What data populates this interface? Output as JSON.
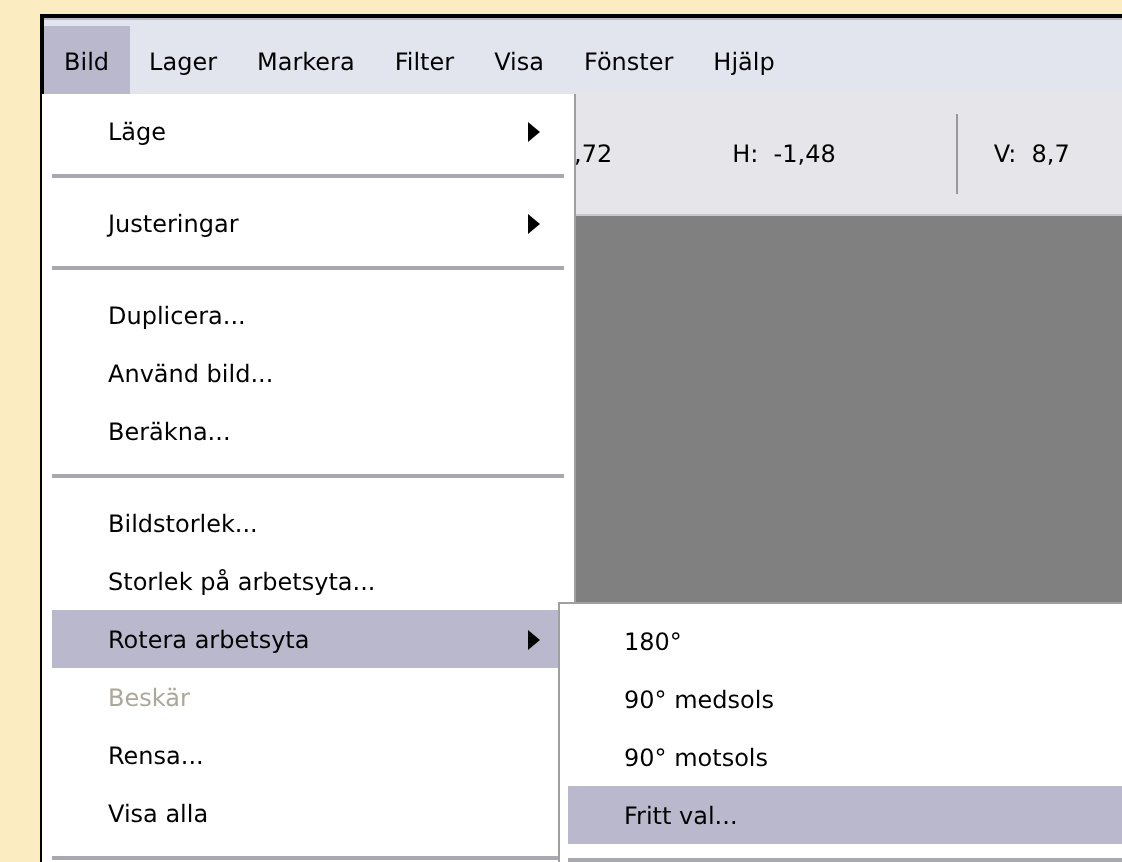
{
  "menubar": [
    {
      "label": "Bild",
      "selected": true
    },
    {
      "label": "Lager",
      "selected": false
    },
    {
      "label": "Markera",
      "selected": false
    },
    {
      "label": "Filter",
      "selected": false
    },
    {
      "label": "Visa",
      "selected": false
    },
    {
      "label": "Fönster",
      "selected": false
    },
    {
      "label": "Hjälp",
      "selected": false
    }
  ],
  "toolbar": {
    "readings": [
      ",72",
      "H:  -1,48",
      "V:  8,7"
    ]
  },
  "menu": {
    "items": [
      {
        "kind": "item",
        "label": "Läge",
        "submenu": true,
        "disabled": false,
        "selected": false
      },
      {
        "kind": "separator"
      },
      {
        "kind": "item",
        "label": "Justeringar",
        "submenu": true,
        "disabled": false,
        "selected": false
      },
      {
        "kind": "separator"
      },
      {
        "kind": "item",
        "label": "Duplicera...",
        "submenu": false,
        "disabled": false,
        "selected": false
      },
      {
        "kind": "item",
        "label": "Använd bild...",
        "submenu": false,
        "disabled": false,
        "selected": false
      },
      {
        "kind": "item",
        "label": "Beräkna...",
        "submenu": false,
        "disabled": false,
        "selected": false
      },
      {
        "kind": "separator"
      },
      {
        "kind": "item",
        "label": "Bildstorlek...",
        "submenu": false,
        "disabled": false,
        "selected": false
      },
      {
        "kind": "item",
        "label": "Storlek på arbetsyta...",
        "submenu": false,
        "disabled": false,
        "selected": false
      },
      {
        "kind": "item",
        "label": "Rotera arbetsyta",
        "submenu": true,
        "disabled": false,
        "selected": true
      },
      {
        "kind": "item",
        "label": "Beskär",
        "submenu": false,
        "disabled": true,
        "selected": false
      },
      {
        "kind": "item",
        "label": "Rensa...",
        "submenu": false,
        "disabled": false,
        "selected": false
      },
      {
        "kind": "item",
        "label": "Visa alla",
        "submenu": false,
        "disabled": false,
        "selected": false
      },
      {
        "kind": "separator"
      }
    ]
  },
  "submenu": {
    "items": [
      {
        "kind": "item",
        "label": "180°",
        "selected": false
      },
      {
        "kind": "item",
        "label": "90° medsols",
        "selected": false
      },
      {
        "kind": "item",
        "label": "90° motsols",
        "selected": false
      },
      {
        "kind": "item",
        "label": "Fritt val...",
        "selected": true
      },
      {
        "kind": "separator"
      }
    ]
  }
}
